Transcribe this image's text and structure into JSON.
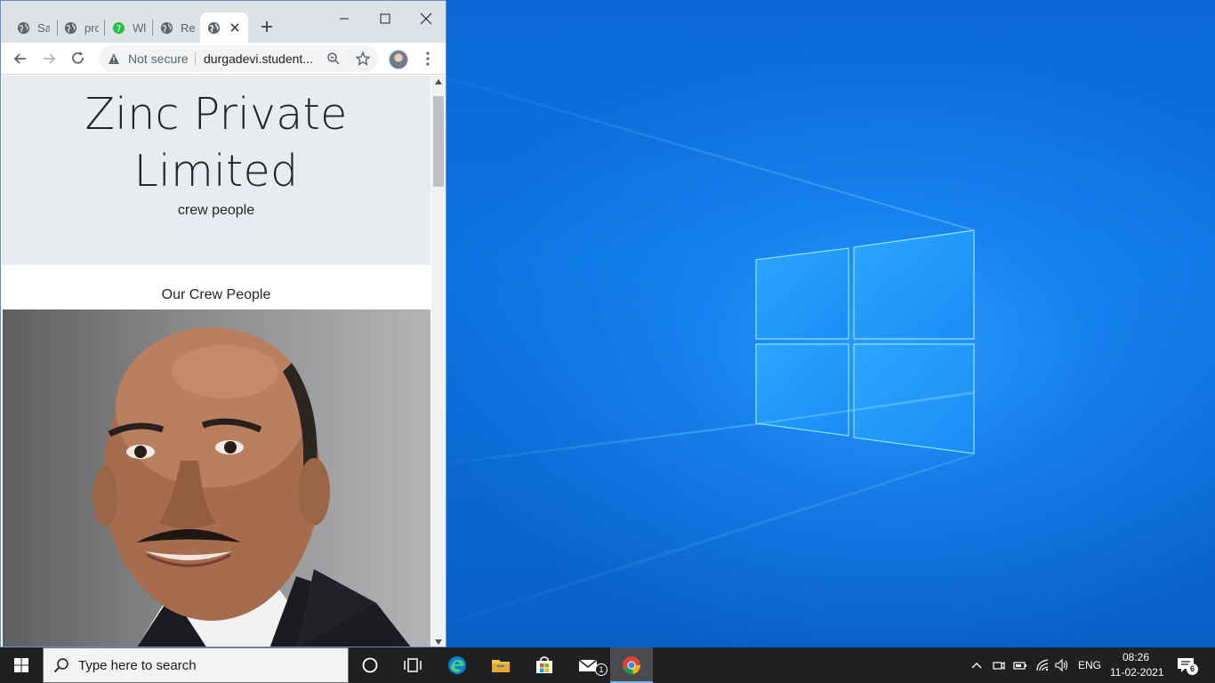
{
  "browser": {
    "tabs": [
      {
        "title": "Sa"
      },
      {
        "title": "pro"
      },
      {
        "title": "Wl"
      },
      {
        "title": "Re"
      },
      {
        "title": ""
      }
    ],
    "address": {
      "security_label": "Not secure",
      "url": "durgadevi.student..."
    }
  },
  "page": {
    "hero_title": "Zinc Private Limited",
    "hero_subtitle": "crew people",
    "section_heading": "Our Crew People"
  },
  "taskbar": {
    "search_placeholder": "Type here to search",
    "mail_badge": "1",
    "language": "ENG",
    "time": "08:26",
    "date": "11-02-2021",
    "notification_count": "6"
  },
  "colors": {
    "chrome_tab_strip": "#dee1e6",
    "hero_background": "#e9ecef",
    "taskbar": "#1f2022",
    "desktop_blue": "#0b73e0"
  }
}
